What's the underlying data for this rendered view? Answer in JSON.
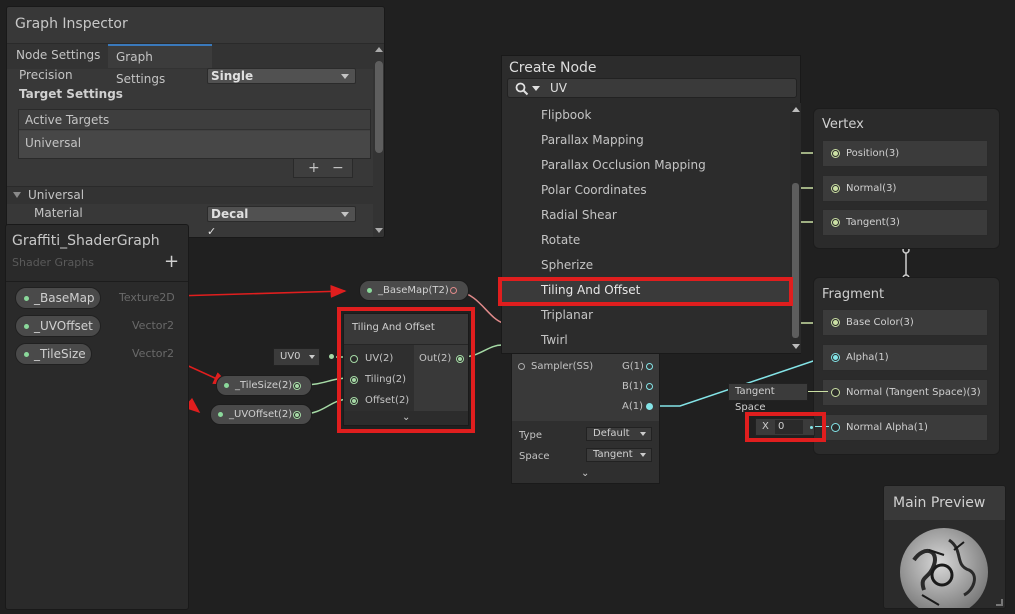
{
  "inspector": {
    "title": "Graph Inspector",
    "tabs": [
      "Node Settings",
      "Graph Settings"
    ],
    "precision_label": "Precision",
    "precision_value": "Single",
    "target_settings": "Target Settings",
    "active_targets": "Active Targets",
    "target_item": "Universal",
    "plus": "+",
    "minus": "−",
    "section": "Universal",
    "material_label": "Material",
    "material_value": "Decal",
    "check": "✓"
  },
  "blackboard": {
    "title": "Graffiti_ShaderGraph",
    "subtitle": "Shader Graphs",
    "add": "+",
    "properties": [
      {
        "name": "_BaseMap",
        "type": "Texture2D"
      },
      {
        "name": "_UVOffset",
        "type": "Vector2"
      },
      {
        "name": "_TileSize",
        "type": "Vector2"
      }
    ]
  },
  "canvas": {
    "basemap_node": "_BaseMap(T2)",
    "tilesize_node": "_TileSize(2)",
    "uvoffset_node": "_UVOffset(2)",
    "uv_dropdown": "UV0",
    "tiling_node": {
      "title": "Tiling And Offset",
      "inputs": [
        "UV(2)",
        "Tiling(2)",
        "Offset(2)"
      ],
      "output": "Out(2)"
    },
    "sampler": {
      "ports": [
        "Sampler(SS)",
        "G(1)",
        "B(1)",
        "A(1)"
      ],
      "type_label": "Type",
      "type_value": "Default",
      "space_label": "Space",
      "space_value": "Tangent"
    }
  },
  "create_node": {
    "title": "Create Node",
    "search_value": "UV",
    "items": [
      "Flipbook",
      "Parallax Mapping",
      "Parallax Occlusion Mapping",
      "Polar Coordinates",
      "Radial Shear",
      "Rotate",
      "Spherize",
      "Tiling And Offset",
      "Triplanar",
      "Twirl"
    ],
    "selected": "Tiling And Offset"
  },
  "vertex": {
    "title": "Vertex",
    "slots": [
      "Position(3)",
      "Normal(3)",
      "Tangent(3)"
    ]
  },
  "fragment": {
    "title": "Fragment",
    "slots": [
      "Base Color(3)",
      "Alpha(1)",
      "Normal (Tangent Space)(3)",
      "Normal Alpha(1)"
    ],
    "tangent_space": "Tangent Space",
    "x_label": "X",
    "x_value": "0"
  },
  "preview": {
    "title": "Main Preview"
  },
  "colors": {
    "highlight": "#e01e1e",
    "accent": "#3a79bb",
    "vector_port": "#a5d9a5",
    "float_port": "#84e4e7"
  }
}
